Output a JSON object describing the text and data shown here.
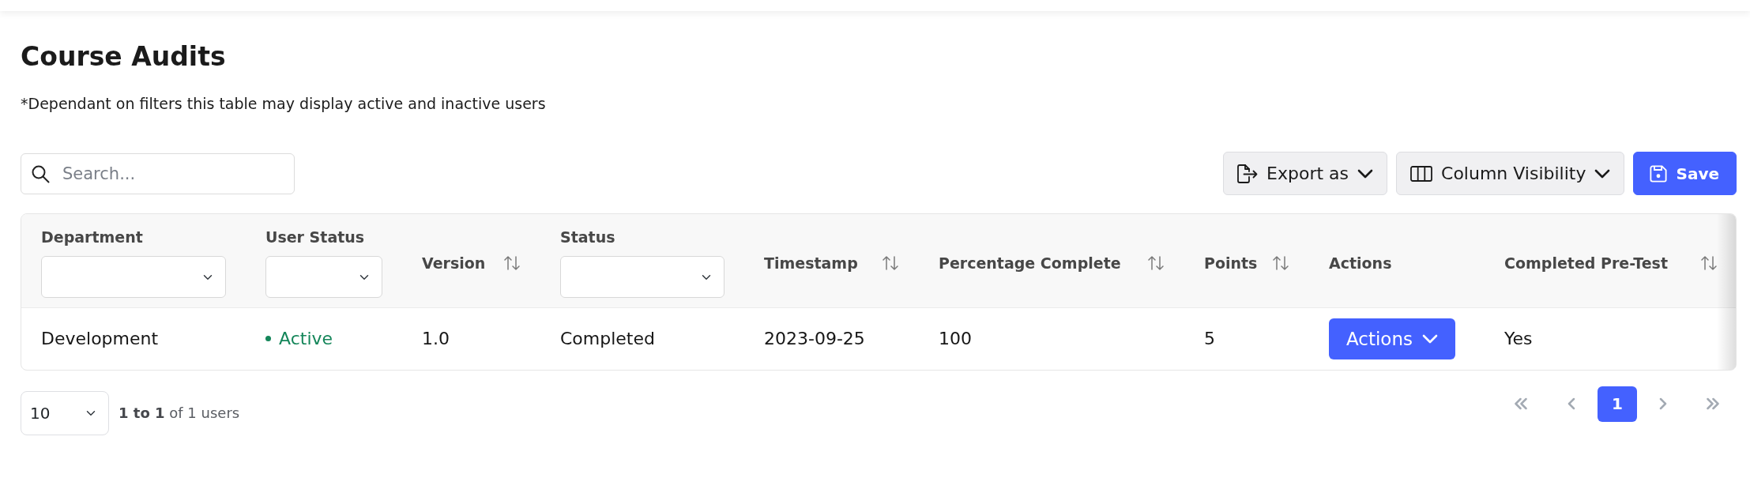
{
  "page": {
    "title": "Course Audits",
    "note": "*Dependant on filters this table may display active and inactive users"
  },
  "toolbar": {
    "search": {
      "placeholder": "Search..."
    },
    "buttons": [
      {
        "label": "Export as",
        "kind": "export"
      },
      {
        "label": "Column Visibility",
        "kind": "columns"
      },
      {
        "label": "Save",
        "kind": "save"
      }
    ]
  },
  "table": {
    "columns": [
      {
        "label": "Department",
        "kind": "filter"
      },
      {
        "label": "User Status",
        "kind": "filter"
      },
      {
        "label": "Version",
        "kind": "sortable"
      },
      {
        "label": "Status",
        "kind": "filter"
      },
      {
        "label": "Timestamp",
        "kind": "sortable"
      },
      {
        "label": "Percentage Complete",
        "kind": "sortable"
      },
      {
        "label": "Points",
        "kind": "sortable"
      },
      {
        "label": "Actions",
        "kind": "plain"
      },
      {
        "label": "Completed Pre-Test",
        "kind": "sortable"
      }
    ],
    "rows": [
      {
        "cells": [
          {
            "kind": "text",
            "text": "Development"
          },
          {
            "kind": "status",
            "text": "Active"
          },
          {
            "kind": "text",
            "text": "1.0"
          },
          {
            "kind": "text",
            "text": "Completed"
          },
          {
            "kind": "text",
            "text": "2023-09-25"
          },
          {
            "kind": "text",
            "text": "100"
          },
          {
            "kind": "text",
            "text": "5"
          },
          {
            "kind": "button",
            "text": "Actions"
          },
          {
            "kind": "text",
            "text": "Yes"
          }
        ]
      }
    ]
  },
  "footer": {
    "page_size": "10",
    "summary": "**1 to 1** of 1 users",
    "pagination": [
      {
        "kind": "first",
        "disabled": true
      },
      {
        "kind": "prev",
        "disabled": true
      },
      {
        "kind": "page",
        "label": "1",
        "selected": true
      },
      {
        "kind": "next",
        "disabled": true
      },
      {
        "kind": "last",
        "disabled": true
      }
    ]
  }
}
